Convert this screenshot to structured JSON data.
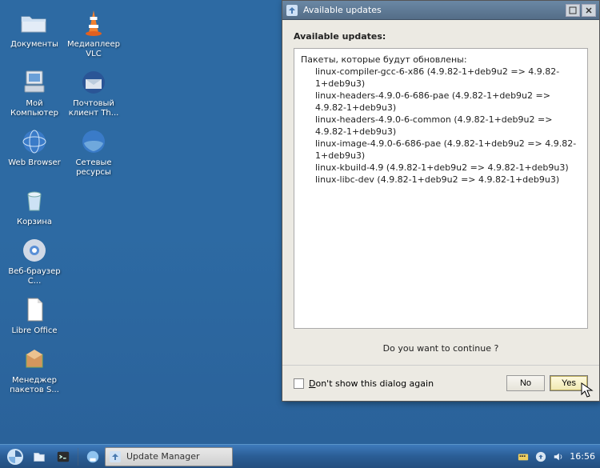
{
  "desktop": {
    "icons": [
      {
        "label": "Документы",
        "name": "documents-icon"
      },
      {
        "label": "Медиаплеер VLC",
        "name": "vlc-icon"
      },
      {
        "label": "Мой Компьютер",
        "name": "my-computer-icon"
      },
      {
        "label": "Почтовый клиент Th...",
        "name": "thunderbird-icon"
      },
      {
        "label": "Web Browser",
        "name": "web-browser-icon"
      },
      {
        "label": "Сетевые ресурсы",
        "name": "network-places-icon"
      },
      {
        "label": "Корзина",
        "name": "trash-icon"
      },
      {
        "label": "Веб-браузер C...",
        "name": "chromium-icon"
      },
      {
        "label": "Libre Office",
        "name": "libreoffice-icon"
      },
      {
        "label": "Менеджер пакетов S...",
        "name": "synaptic-icon"
      }
    ]
  },
  "taskbar": {
    "task_label": "Update Manager",
    "clock": "16:56"
  },
  "dialog": {
    "title": "Available updates",
    "heading": "Available updates:",
    "list_header": "Пакеты, которые будут обновлены:",
    "packages": [
      "linux-compiler-gcc-6-x86 (4.9.82-1+deb9u2 => 4.9.82-1+deb9u3)",
      "linux-headers-4.9.0-6-686-pae (4.9.82-1+deb9u2 => 4.9.82-1+deb9u3)",
      "linux-headers-4.9.0-6-common (4.9.82-1+deb9u2 => 4.9.82-1+deb9u3)",
      "linux-image-4.9.0-6-686-pae (4.9.82-1+deb9u2 => 4.9.82-1+deb9u3)",
      "linux-kbuild-4.9 (4.9.82-1+deb9u2 => 4.9.82-1+deb9u3)",
      "linux-libc-dev (4.9.82-1+deb9u2 => 4.9.82-1+deb9u3)"
    ],
    "question": "Do you want to continue ?",
    "dont_show_prefix": "D",
    "dont_show_rest": "on't show this dialog again",
    "btn_no_prefix": "N",
    "btn_no_rest": "o",
    "btn_yes_prefix": "Y",
    "btn_yes_rest": "es"
  }
}
